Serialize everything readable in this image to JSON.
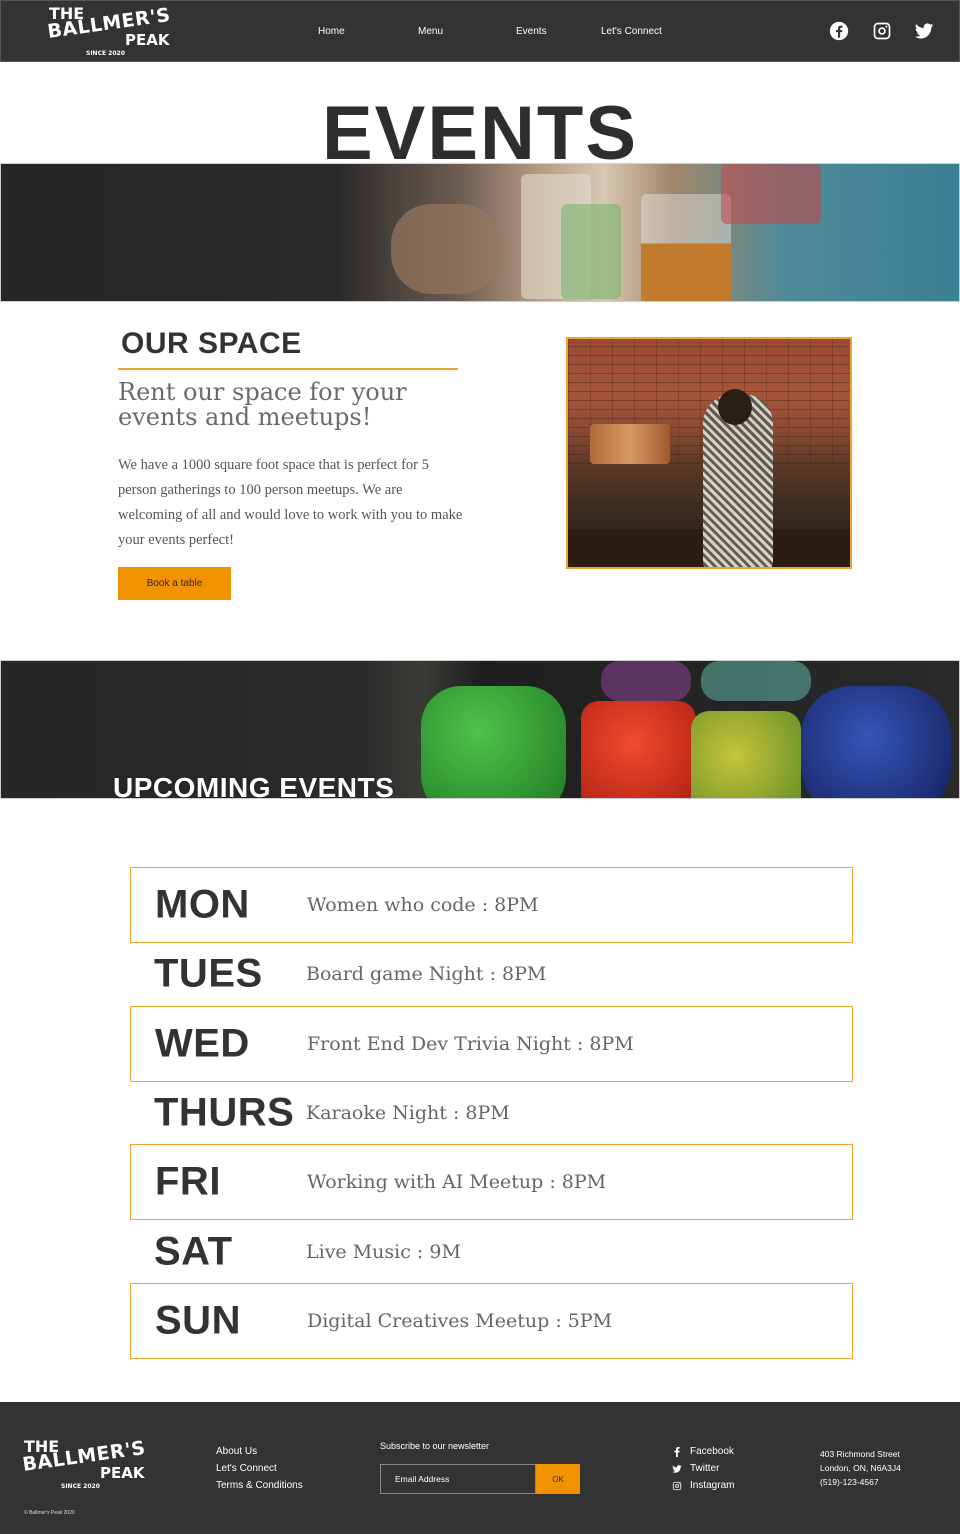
{
  "brand": {
    "line1": "THE",
    "line2": "BALLMER'S",
    "line3": "PEAK",
    "line4": "SINCE 2020"
  },
  "nav": {
    "links": [
      "Home",
      "Menu",
      "Events",
      "Let's Connect"
    ],
    "social_icons": [
      "facebook-icon",
      "instagram-icon",
      "twitter-icon"
    ]
  },
  "hero": {
    "title": "EVENTS"
  },
  "space": {
    "heading": "OUR SPACE",
    "subheading": "Rent our space for your events and meetups!",
    "body": "We have a 1000 square foot space that is perfect for 5 person gatherings to 100 person meetups. We are welcoming of all and would love to work with you to make your events perfect!",
    "button_label": "Book a table"
  },
  "upcoming": {
    "title": "UPCOMING EVENTS",
    "events": [
      {
        "day": "MON",
        "name": "Women who code : 8PM"
      },
      {
        "day": "TUES",
        "name": "Board game Night : 8PM"
      },
      {
        "day": "WED",
        "name": "Front End Dev Trivia Night : 8PM"
      },
      {
        "day": "THURS",
        "name": "Karaoke Night : 8PM"
      },
      {
        "day": "FRI",
        "name": "Working with AI Meetup : 8PM"
      },
      {
        "day": "SAT",
        "name": "Live Music : 9M"
      },
      {
        "day": "SUN",
        "name": "Digital Creatives Meetup : 5PM"
      }
    ]
  },
  "footer": {
    "links": [
      "About Us",
      "Let's Connect",
      "Terms & Conditions"
    ],
    "newsletter_label": "Subscribe to our newsletter",
    "email_placeholder": "Email Address",
    "ok_label": "OK",
    "social": [
      {
        "icon": "facebook-icon",
        "label": "Facebook"
      },
      {
        "icon": "twitter-icon",
        "label": "Twitter"
      },
      {
        "icon": "instagram-icon",
        "label": "Instagram"
      }
    ],
    "address": [
      "403 Richmond Street",
      "London, ON, N6A3J4",
      "(519)-123-4567"
    ],
    "copyright": "© Ballmer's Peak 2020"
  },
  "colors": {
    "accent": "#f39200",
    "dark": "#333333"
  }
}
